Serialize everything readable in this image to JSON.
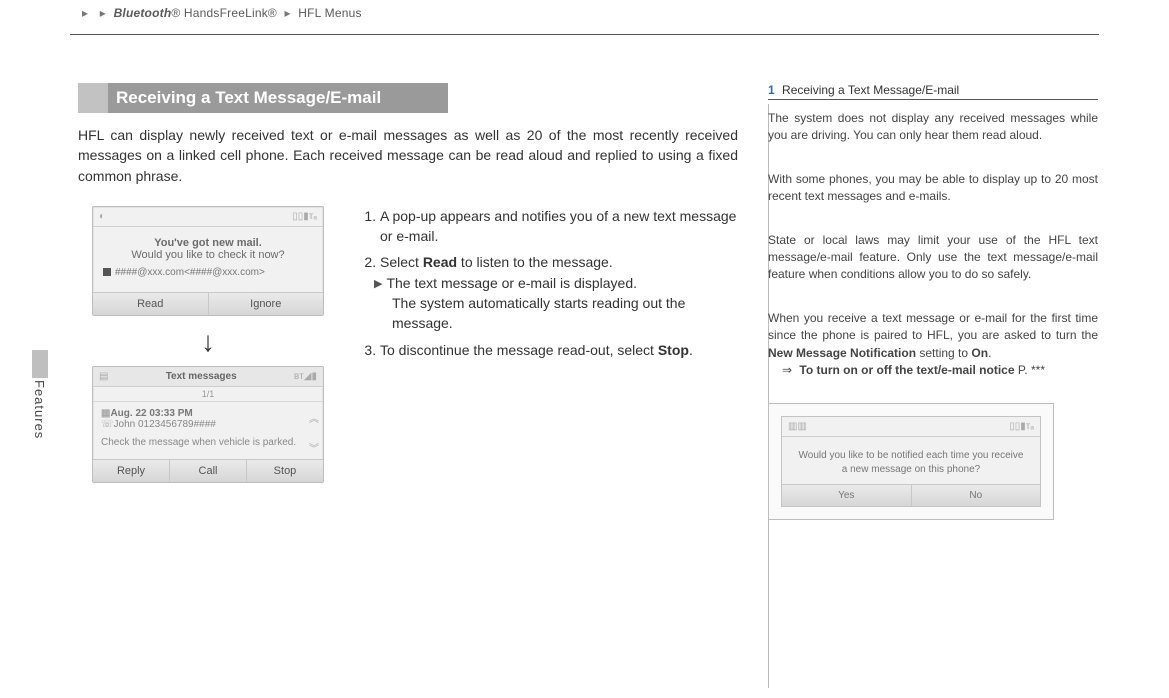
{
  "breadcrumb": {
    "section_italic": "Bluetooth",
    "section_rest": "® HandsFreeLink®",
    "page": "HFL Menus"
  },
  "side_tab": "Features",
  "section_title": "Receiving a Text Message/E-mail",
  "intro": "HFL can display newly received text or e-mail messages as well as 20 of the most recently received messages on a linked cell phone. Each received message can be read aloud and replied to using a fixed common phrase.",
  "steps": {
    "s1": "A pop-up appears and notifies you of a new text message or e-mail.",
    "s2a": "Select ",
    "s2b": "Read",
    "s2c": " to listen to the message.",
    "s2sub1": "The text message or e-mail is displayed.",
    "s2sub2": "The system automatically starts reading out the message.",
    "s3a": "To discontinue the message read-out, select ",
    "s3b": "Stop",
    "s3c": "."
  },
  "device1": {
    "status_left": "◐",
    "status_right": "▯▯▮ᴛₐ",
    "line1": "You've got new mail.",
    "line2": "Would you like to check it now?",
    "addr": "####@xxx.com<####@xxx.com>",
    "btn_read": "Read",
    "btn_ignore": "Ignore"
  },
  "device2": {
    "icon_l": "▤",
    "hdr": "Text messages",
    "icon_r": "ʙᴛ◢▮",
    "page": "1/1",
    "date": "Aug. 22 03:33 PM",
    "from": "John 0123456789####",
    "body": "Check the message when vehicle is parked.",
    "btn_reply": "Reply",
    "btn_call": "Call",
    "btn_stop": "Stop"
  },
  "sidebar": {
    "index": "1",
    "title": "Receiving a Text Message/E-mail",
    "p1": "The system does not display any received messages while you are driving. You can only hear them read aloud.",
    "p2": "With some phones, you may be able to display up to 20 most recent text messages and e-mails.",
    "p3": "State or local laws may limit your use of the HFL text message/e-mail feature. Only use the text message/e-mail feature when conditions allow you to do so safely.",
    "p4a": "When you receive a text message or e-mail for the first time since the phone is paired to HFL, you are asked to turn the ",
    "p4b": "New Message Notification",
    "p4c": " setting to ",
    "p4d": "On",
    "p4e": ".",
    "link_arrow": "⇒",
    "link_text": "To turn on or off the text/e-mail notice",
    "link_page": " P. ***"
  },
  "device3": {
    "status_left": "▥▥",
    "status_right": "▯▯▮ᴛₐ",
    "prompt": "Would you like to be notified each time you receive a new message on this phone?",
    "btn_yes": "Yes",
    "btn_no": "No"
  }
}
